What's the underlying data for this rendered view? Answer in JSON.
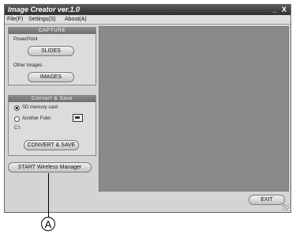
{
  "window": {
    "title": "Image Creator ver.1.0",
    "controls": "_ X"
  },
  "menu": {
    "file": "File(F)",
    "settings": "Settings(S)",
    "about": "About(A)"
  },
  "capture": {
    "header": "CAPTURE",
    "powerpoint_label": "PowerPoint",
    "slides_button": "SLIDES",
    "other_images_label": "Other Images",
    "images_button": "IMAGES"
  },
  "convert": {
    "header": "Convert & Save",
    "option_sd": "SD memory card",
    "option_folder": "Another Foler",
    "path": "C:\\",
    "convert_button": "CONVERT & SAVE"
  },
  "wireless_button": "START Wireless Manager",
  "exit_button": "EXIT",
  "callout": "A"
}
